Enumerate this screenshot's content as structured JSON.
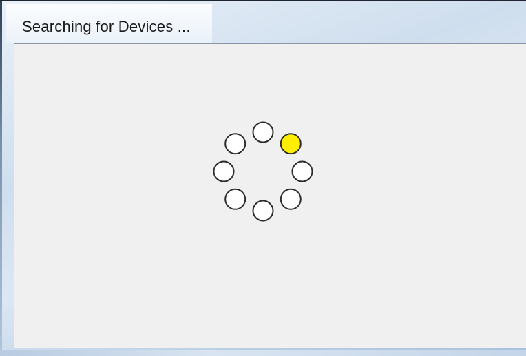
{
  "window": {
    "title": "Searching for Devices ..."
  },
  "spinner": {
    "dot_count": 8,
    "active_index": 1,
    "active_color": "#ffee00",
    "inactive_color": "#ffffff",
    "outline_color": "#2b2b2b"
  }
}
